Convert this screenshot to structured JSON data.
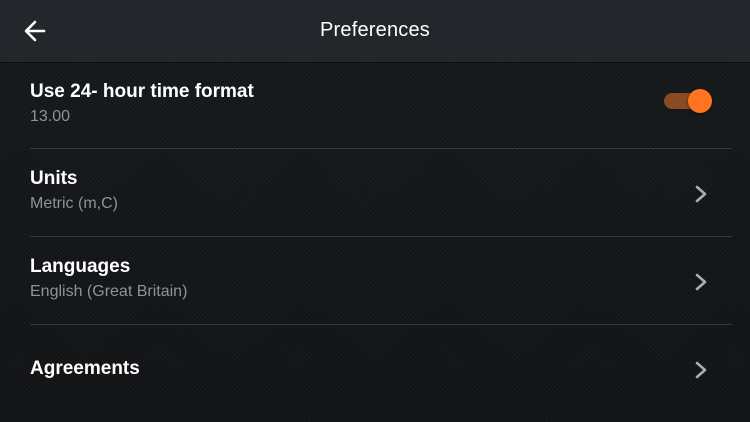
{
  "header": {
    "title": "Preferences",
    "back_icon": "arrow-left-icon"
  },
  "settings": {
    "time_format": {
      "label": "Use 24- hour time format",
      "value": "13.00",
      "enabled": true,
      "accent_color": "#ff7420"
    },
    "units": {
      "label": "Units",
      "value": "Metric (m,C)",
      "icon": "chevron-right-icon"
    },
    "languages": {
      "label": "Languages",
      "value": "English (Great Britain)",
      "icon": "chevron-right-icon"
    },
    "agreements": {
      "label": "Agreements",
      "icon": "chevron-right-icon"
    }
  }
}
